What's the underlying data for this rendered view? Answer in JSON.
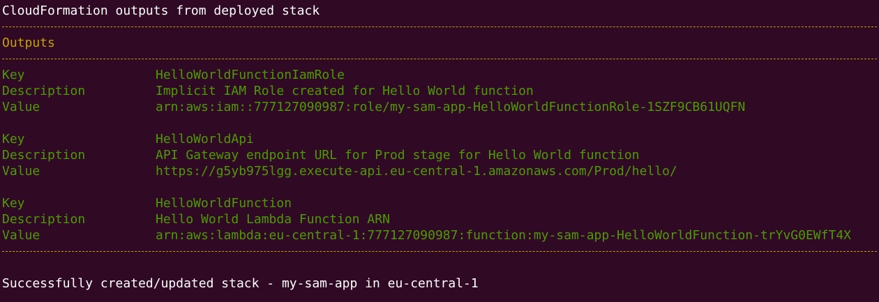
{
  "title": "CloudFormation outputs from deployed stack",
  "section_heading": "Outputs",
  "colors": {
    "background": "#300a24",
    "text": "#ffffff",
    "header": "#c4a000",
    "output": "#4e9a06"
  },
  "outputs": [
    {
      "key_label": "Key",
      "key_value": "HelloWorldFunctionIamRole",
      "description_label": "Description",
      "description_value": "Implicit IAM Role created for Hello World function",
      "value_label": "Value",
      "value_value": "arn:aws:iam::777127090987:role/my-sam-app-HelloWorldFunctionRole-1SZF9CB61UQFN"
    },
    {
      "key_label": "Key",
      "key_value": "HelloWorldApi",
      "description_label": "Description",
      "description_value": "API Gateway endpoint URL for Prod stage for Hello World function",
      "value_label": "Value",
      "value_value": "https://g5yb975lgg.execute-api.eu-central-1.amazonaws.com/Prod/hello/"
    },
    {
      "key_label": "Key",
      "key_value": "HelloWorldFunction",
      "description_label": "Description",
      "description_value": "Hello World Lambda Function ARN",
      "value_label": "Value",
      "value_value": "arn:aws:lambda:eu-central-1:777127090987:function:my-sam-app-HelloWorldFunction-trYvG0EWfT4X"
    }
  ],
  "status_message": "Successfully created/updated stack - my-sam-app in eu-central-1"
}
